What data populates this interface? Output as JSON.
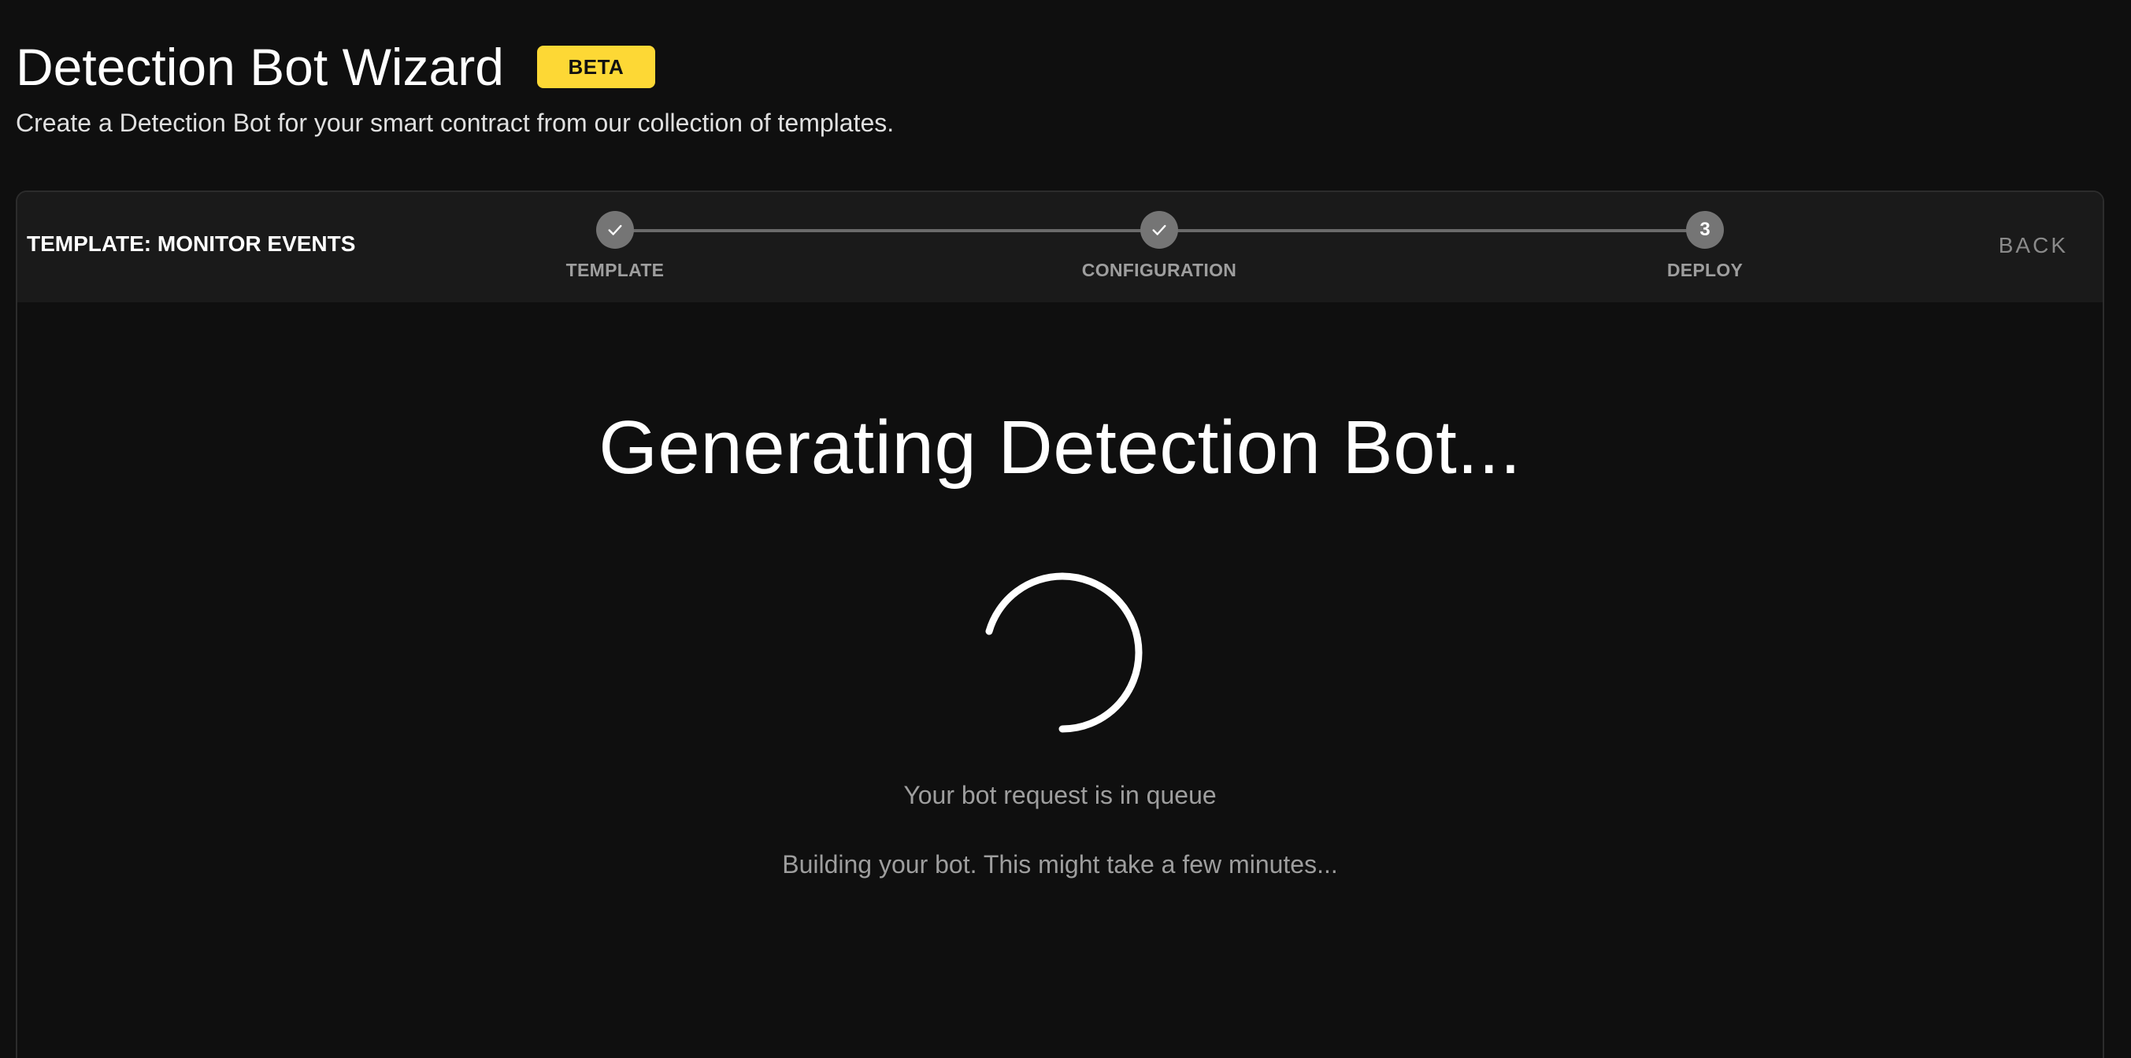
{
  "header": {
    "title": "Detection Bot Wizard",
    "badge": "BETA",
    "subtitle": "Create a Detection Bot for your smart contract from our collection of templates."
  },
  "wizard": {
    "template_label": "TEMPLATE: MONITOR EVENTS",
    "back_label": "BACK",
    "steps": [
      {
        "label": "TEMPLATE",
        "state": "completed",
        "icon": "check-icon"
      },
      {
        "label": "CONFIGURATION",
        "state": "completed",
        "icon": "check-icon"
      },
      {
        "label": "DEPLOY",
        "state": "current",
        "number": "3"
      }
    ]
  },
  "status": {
    "heading": "Generating Detection Bot...",
    "queue_message": "Your bot request is in queue",
    "building_message": "Building your bot. This might take a few minutes..."
  },
  "colors": {
    "background": "#0f0f0f",
    "badge": "#fdd835",
    "step_circle": "#757575",
    "muted_text": "#9e9e9e"
  }
}
